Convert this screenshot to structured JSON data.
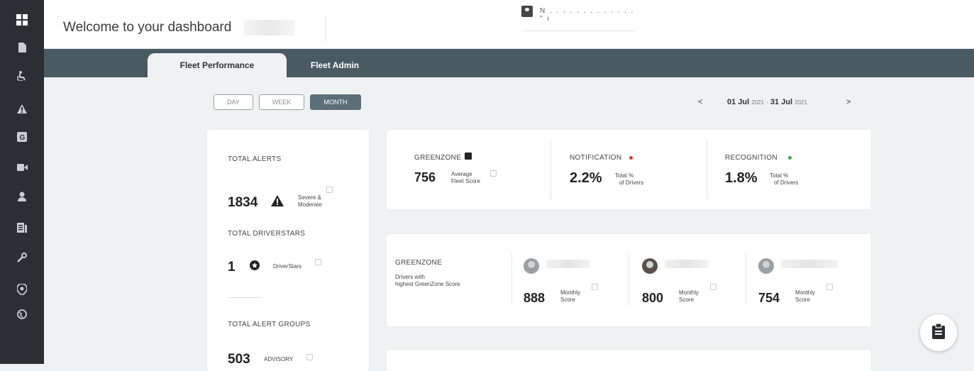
{
  "header": {
    "welcome": "Welcome to your dashboard",
    "user_name": "N . . . . . . . . . . . . . \" ı"
  },
  "tabs": [
    {
      "label": "Fleet Performance",
      "active": true
    },
    {
      "label": "Fleet Admin",
      "active": false
    }
  ],
  "period": {
    "options": [
      "DAY",
      "WEEK",
      "MONTH"
    ],
    "selected": "MONTH"
  },
  "date_nav": {
    "prev": "<",
    "next": ">",
    "start_day": "01 Jul",
    "start_year": "2021",
    "separator": "-",
    "end_day": "31 Jul",
    "end_year": "2021"
  },
  "summary": {
    "total_alerts": {
      "label": "TOTAL ALERTS",
      "value": "1834",
      "desc_line1": "Severe &",
      "desc_line2": "Moderate"
    },
    "total_driverstars": {
      "label": "TOTAL DRIVERSTARS",
      "value": "1",
      "desc": "DriverStars"
    },
    "total_alert_groups": {
      "label": "TOTAL ALERT GROUPS",
      "value": "503",
      "desc": "ADVISORY"
    }
  },
  "kpis": {
    "greenzone": {
      "label": "GREENZONE",
      "value": "756",
      "desc_line1": "Average",
      "desc_line2": "Fleet Score"
    },
    "notification": {
      "label": "NOTIFICATION",
      "value": "2.2%",
      "desc_line1": "Total %",
      "desc_line2": "of Drivers",
      "dot_color": "#e53935"
    },
    "recognition": {
      "label": "RECOGNITION",
      "value": "1.8%",
      "desc_line1": "Total %",
      "desc_line2": "of Drivers",
      "dot_color": "#43a047"
    }
  },
  "top_drivers": {
    "title": "GREENZONE",
    "sub_line1": "Drivers with",
    "sub_line2": "highest GreenZone Score",
    "drivers": [
      {
        "score": "888",
        "desc_line1": "Monthly",
        "desc_line2": "Score"
      },
      {
        "score": "800",
        "desc_line1": "Monthly",
        "desc_line2": "Score"
      },
      {
        "score": "754",
        "desc_line1": "Monthly",
        "desc_line2": "Score"
      }
    ]
  },
  "icons": {
    "sidebar": [
      "dashboard-icon",
      "document-icon",
      "accessibility-icon",
      "warning-icon",
      "g-badge-icon",
      "video-icon",
      "user-icon",
      "report-icon",
      "wrench-icon",
      "location-shield-icon",
      "globe-icon"
    ],
    "fab": "clipboard-icon"
  },
  "colors": {
    "sidebar_bg": "#2b2f33",
    "tabbar_bg": "#4a5a62",
    "active_period": "#5c6e78"
  }
}
